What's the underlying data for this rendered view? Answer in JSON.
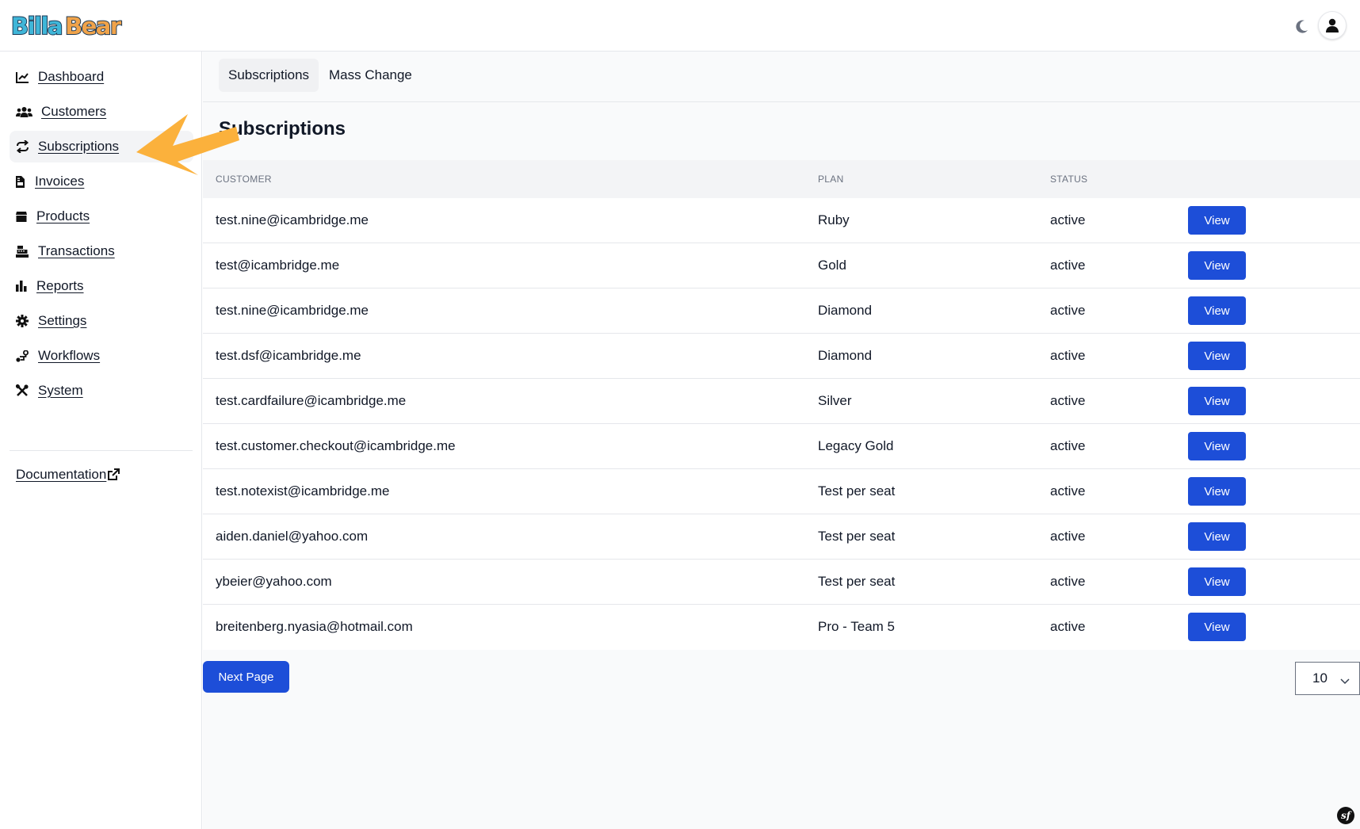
{
  "app": {
    "logo_text": "BillaBear"
  },
  "header": {
    "theme_icon": "moon-icon",
    "avatar_icon": "user-icon"
  },
  "sidebar": {
    "items": [
      {
        "label": "Dashboard",
        "icon": "chart-line-icon"
      },
      {
        "label": "Customers",
        "icon": "users-icon"
      },
      {
        "label": "Subscriptions",
        "icon": "repeat-icon",
        "active": true
      },
      {
        "label": "Invoices",
        "icon": "file-invoice-icon"
      },
      {
        "label": "Products",
        "icon": "box-icon"
      },
      {
        "label": "Transactions",
        "icon": "cash-register-icon"
      },
      {
        "label": "Reports",
        "icon": "bar-chart-icon"
      },
      {
        "label": "Settings",
        "icon": "gear-icon"
      },
      {
        "label": "Workflows",
        "icon": "workflow-icon"
      },
      {
        "label": "System",
        "icon": "tools-icon"
      }
    ],
    "documentation_label": "Documentation"
  },
  "subnav": {
    "tabs": [
      {
        "label": "Subscriptions",
        "active": true
      },
      {
        "label": "Mass Change",
        "active": false
      }
    ]
  },
  "page": {
    "title": "Subscriptions"
  },
  "table": {
    "headers": {
      "customer": "CUSTOMER",
      "plan": "PLAN",
      "status": "STATUS"
    },
    "rows": [
      {
        "customer": "test.nine@icambridge.me",
        "plan": "Ruby",
        "status": "active",
        "action": "View"
      },
      {
        "customer": "test@icambridge.me",
        "plan": "Gold",
        "status": "active",
        "action": "View"
      },
      {
        "customer": "test.nine@icambridge.me",
        "plan": "Diamond",
        "status": "active",
        "action": "View"
      },
      {
        "customer": "test.dsf@icambridge.me",
        "plan": "Diamond",
        "status": "active",
        "action": "View"
      },
      {
        "customer": "test.cardfailure@icambridge.me",
        "plan": "Silver",
        "status": "active",
        "action": "View"
      },
      {
        "customer": "test.customer.checkout@icambridge.me",
        "plan": "Legacy Gold",
        "status": "active",
        "action": "View"
      },
      {
        "customer": "test.notexist@icambridge.me",
        "plan": "Test per seat",
        "status": "active",
        "action": "View"
      },
      {
        "customer": "aiden.daniel@yahoo.com",
        "plan": "Test per seat",
        "status": "active",
        "action": "View"
      },
      {
        "customer": "ybeier@yahoo.com",
        "plan": "Test per seat",
        "status": "active",
        "action": "View"
      },
      {
        "customer": "breitenberg.nyasia@hotmail.com",
        "plan": "Pro - Team 5",
        "status": "active",
        "action": "View"
      }
    ]
  },
  "pagination": {
    "next_label": "Next Page",
    "per_page": "10"
  },
  "colors": {
    "primary": "#1d4ed8",
    "annotation_arrow": "#fbb13c"
  }
}
